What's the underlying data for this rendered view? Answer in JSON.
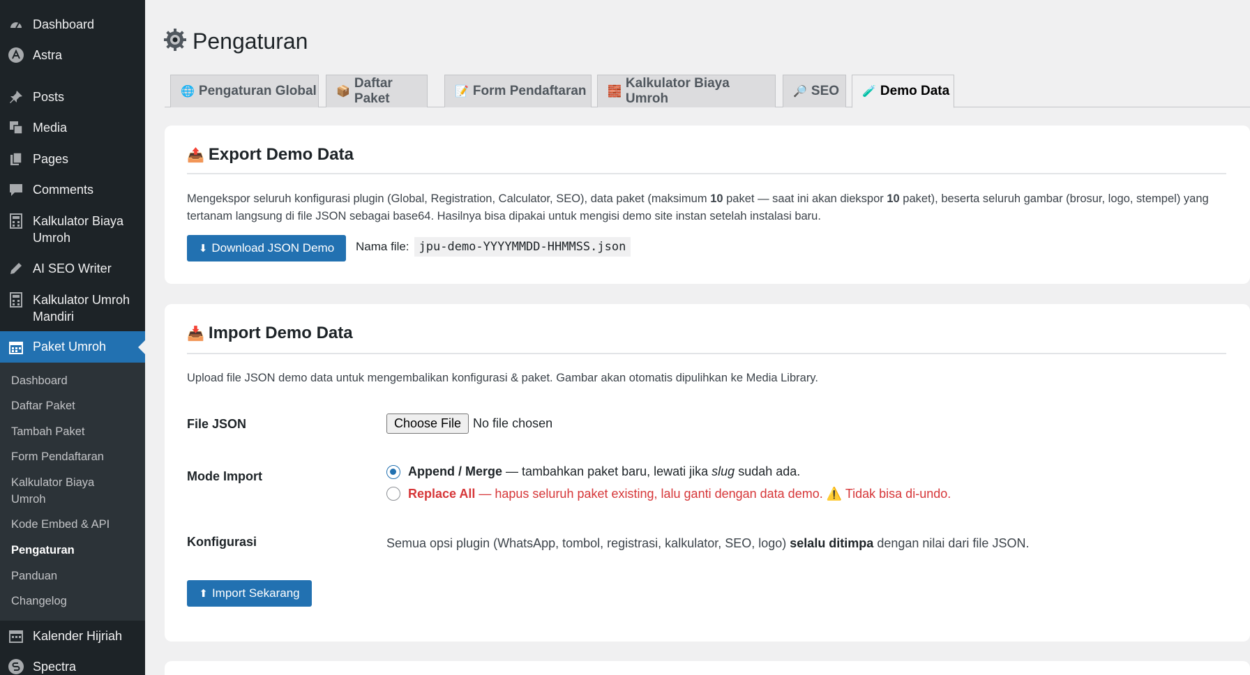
{
  "sidebar": {
    "top_items": [
      {
        "label": "Dashboard",
        "icon": "dashboard-icon"
      },
      {
        "label": "Astra",
        "icon": "astra-icon"
      },
      {
        "label": "Posts",
        "icon": "pin-icon"
      },
      {
        "label": "Media",
        "icon": "media-icon"
      },
      {
        "label": "Pages",
        "icon": "pages-icon"
      },
      {
        "label": "Comments",
        "icon": "comments-icon"
      },
      {
        "label": "Kalkulator Biaya Umroh",
        "icon": "calculator-icon"
      },
      {
        "label": "AI SEO Writer",
        "icon": "pencil-icon"
      },
      {
        "label": "Kalkulator Umroh Mandiri",
        "icon": "calculator-icon"
      },
      {
        "label": "Paket Umroh",
        "icon": "calendar-icon"
      }
    ],
    "submenu": [
      "Dashboard",
      "Daftar Paket",
      "Tambah Paket",
      "Form Pendaftaran",
      "Kalkulator Biaya Umroh",
      "Kode Embed & API",
      "Pengaturan",
      "Panduan",
      "Changelog"
    ],
    "bottom_items": [
      {
        "label": "Kalender Hijriah",
        "icon": "calendar-icon"
      },
      {
        "label": "Spectra",
        "icon": "spectra-icon"
      }
    ]
  },
  "header": {
    "title": "Pengaturan",
    "icon": "gear-icon"
  },
  "tabs": [
    {
      "label": "Pengaturan Global",
      "icon": "🌐"
    },
    {
      "label": "Daftar Paket",
      "icon": "📦"
    },
    {
      "label": "Form Pendaftaran",
      "icon": "📝"
    },
    {
      "label": "Kalkulator Biaya Umroh",
      "icon": "🧱"
    },
    {
      "label": "SEO",
      "icon": "🔎"
    },
    {
      "label": "Demo Data",
      "icon": "🧪"
    }
  ],
  "export": {
    "icon": "📤",
    "title": "Export Demo Data",
    "desc_part1": "Mengekspor seluruh konfigurasi plugin (Global, Registration, Calculator, SEO), data paket (maksimum ",
    "desc_max": "10",
    "desc_part2": " paket — saat ini akan diekspor ",
    "desc_count": "10",
    "desc_part3": " paket), beserta seluruh gambar (brosur, logo, stempel) yang tertanam langsung di file JSON sebagai base64. Hasilnya bisa dipakai untuk mengisi demo site instan setelah instalasi baru.",
    "button_label": "Download JSON Demo",
    "button_icon": "⬇",
    "filename_label": "Nama file:",
    "filename": "jpu-demo-YYYYMMDD-HHMMSS.json"
  },
  "import": {
    "icon": "📥",
    "title": "Import Demo Data",
    "desc": "Upload file JSON demo data untuk mengembalikan konfigurasi & paket. Gambar akan otomatis dipulihkan ke Media Library.",
    "file_label": "File JSON",
    "choose_file": "Choose File",
    "no_file": "No file chosen",
    "mode_label": "Mode Import",
    "mode_append_bold": "Append / Merge",
    "mode_append_text_a": " — tambahkan paket baru, lewati jika ",
    "mode_append_slug": "slug",
    "mode_append_text_b": " sudah ada.",
    "mode_replace_bold": "Replace All",
    "mode_replace_text": " — hapus seluruh paket existing, lalu ganti dengan data demo. ",
    "mode_replace_warning": "⚠️",
    "mode_replace_tail": " Tidak bisa di-undo.",
    "config_label": "Konfigurasi",
    "config_text_a": "Semua opsi plugin (WhatsApp, tombol, registrasi, kalkulator, SEO, logo) ",
    "config_bold": "selalu ditimpa",
    "config_text_b": " dengan nilai dari file JSON.",
    "button_label": "Import Sekarang",
    "button_icon": "⬆"
  },
  "colors": {
    "sidebar_bg": "#1d2327",
    "submenu_bg": "#2c3338",
    "accent": "#2271b1",
    "danger": "#d63638"
  }
}
